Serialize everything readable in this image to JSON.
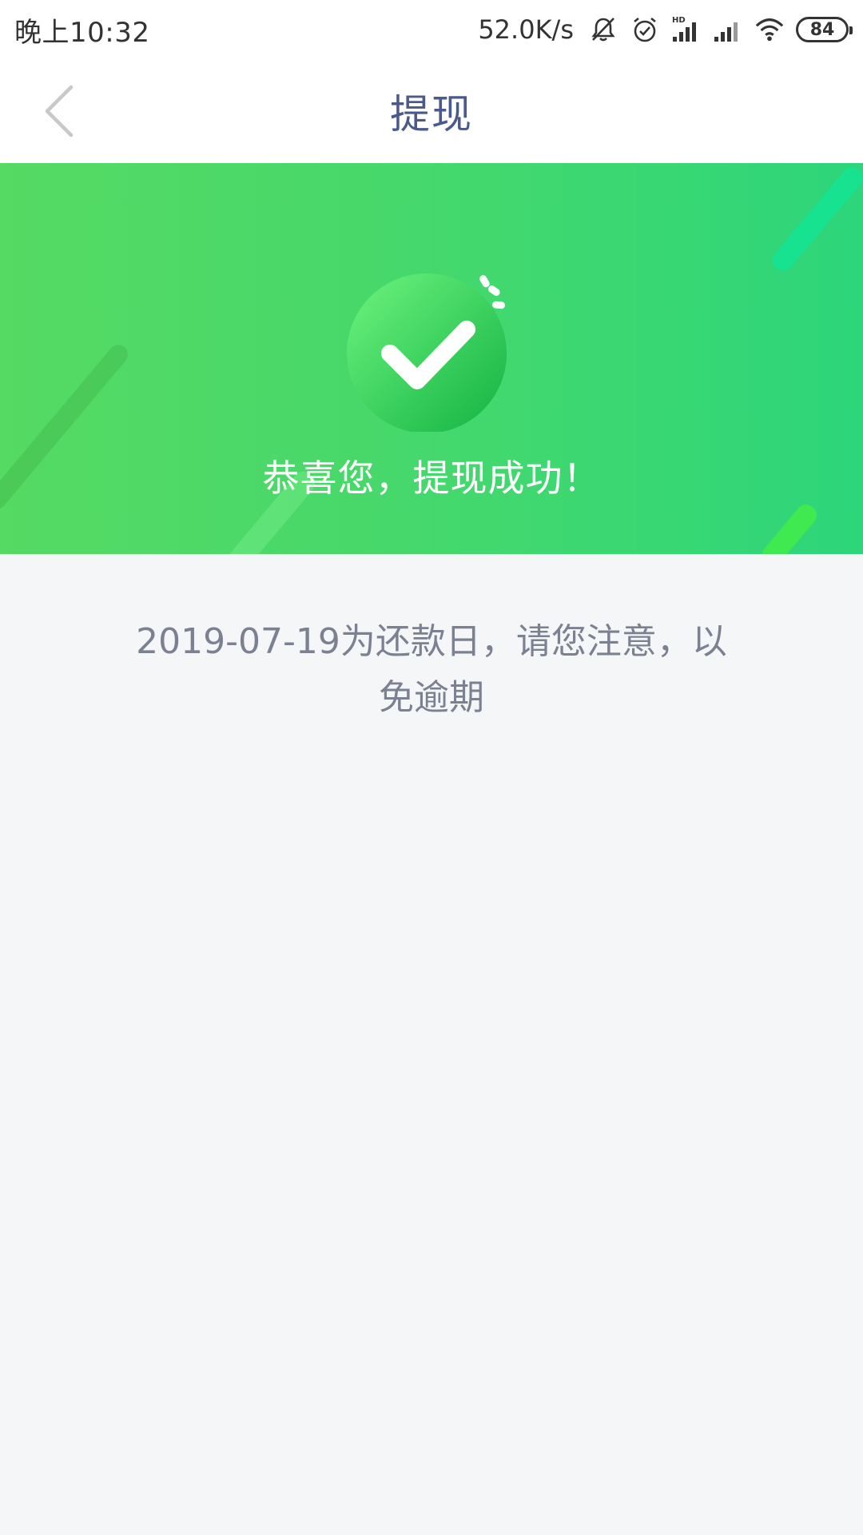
{
  "status_bar": {
    "time": "晚上10:32",
    "net_speed": "52.0K/s",
    "battery": "84",
    "icons": [
      "bell-off-icon",
      "alarm-icon",
      "hd-signal-icon",
      "signal-icon",
      "wifi-icon",
      "battery-icon"
    ]
  },
  "header": {
    "title": "提现",
    "back_icon": "chevron-left-icon"
  },
  "banner": {
    "message": "恭喜您，提现成功！",
    "icon": "check-circle-icon",
    "colors": {
      "gradient_start": "#55da63",
      "gradient_end": "#2dd67a",
      "check_circle": "#23c04a"
    }
  },
  "notice": {
    "text": "2019-07-19为还款日，请您注意，以免逾期"
  }
}
